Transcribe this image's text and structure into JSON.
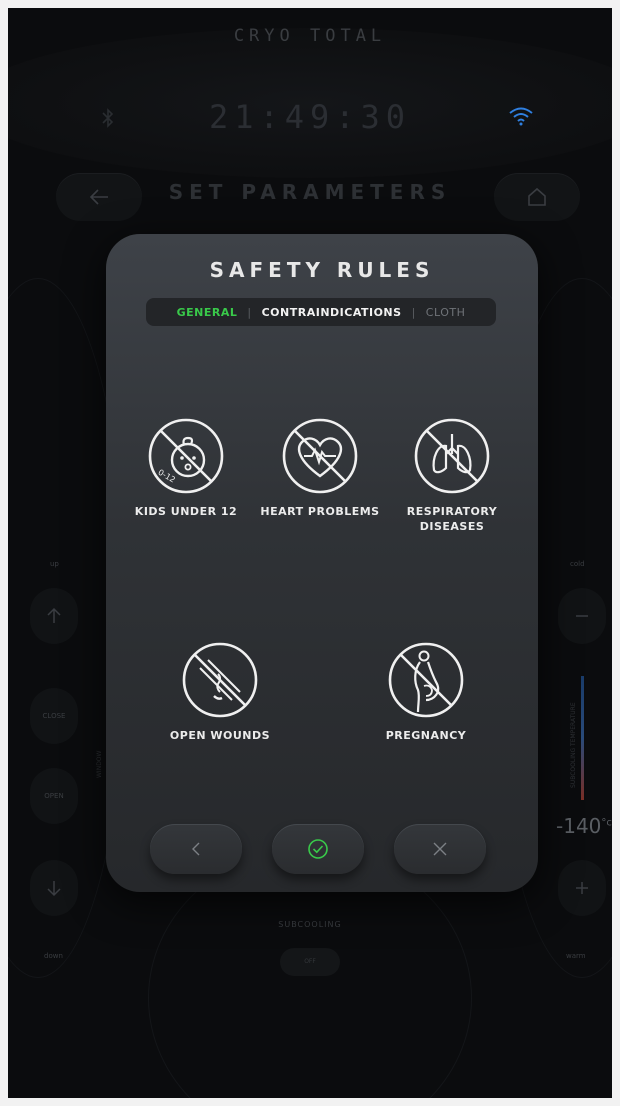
{
  "app": {
    "brand": "CRYO TOTAL",
    "time": "21:49:30",
    "screen_title": "SET PARAMETERS"
  },
  "background": {
    "left_labels": {
      "up": "up",
      "close": "CLOSE",
      "open": "OPEN",
      "down": "down",
      "window": "WINDOW"
    },
    "right_labels": {
      "cold": "cold",
      "warm": "warm",
      "temp_caption": "SUBCOOLING TEMPERATURE"
    },
    "temperature": {
      "value": "-140",
      "unit": "°c"
    },
    "subcooling": {
      "label": "SUBCOOLING",
      "button": "OFF"
    }
  },
  "modal": {
    "title": "SAFETY RULES",
    "tabs": [
      {
        "label": "GENERAL",
        "active": true
      },
      {
        "label": "CONTRAINDICATIONS",
        "active": false
      },
      {
        "label": "CLOTH",
        "active": false
      }
    ],
    "rules": [
      {
        "label": "KIDS UNDER 12",
        "icon": "child-prohibited-icon",
        "icon_text": "0-12"
      },
      {
        "label": "HEART PROBLEMS",
        "icon": "heart-prohibited-icon"
      },
      {
        "label": "RESPIRATORY DISEASES",
        "icon": "lungs-prohibited-icon"
      },
      {
        "label": "OPEN WOUNDS",
        "icon": "wound-prohibited-icon"
      },
      {
        "label": "PREGNANCY",
        "icon": "pregnancy-prohibited-icon"
      }
    ]
  },
  "colors": {
    "accent_green": "#39c94a",
    "wifi_blue": "#2f7fe0",
    "modal_bg": "#2f3236"
  }
}
